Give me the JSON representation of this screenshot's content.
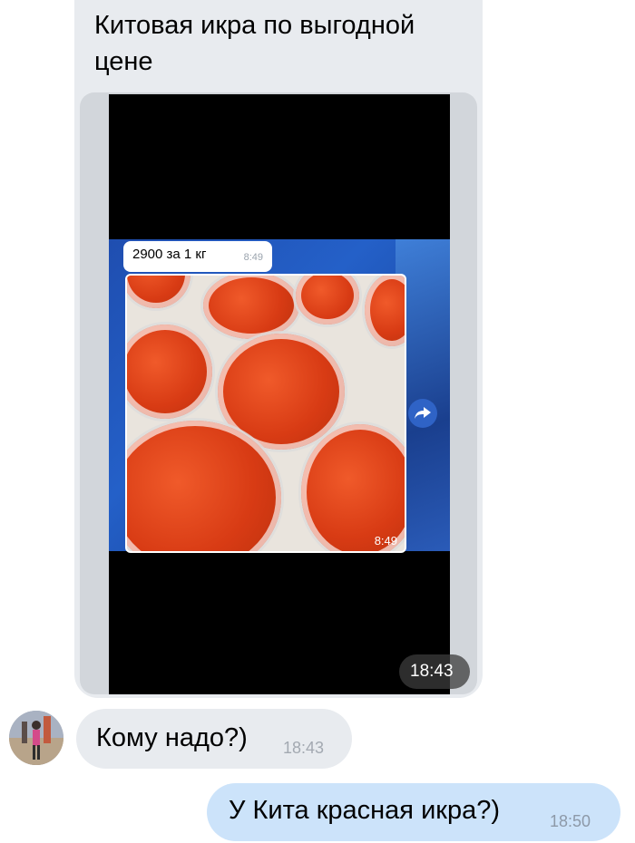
{
  "messages": {
    "first": {
      "text": "Китовая икра по выгодной цене",
      "time": "18:43",
      "attachment": {
        "caption": "2900 за 1 кг",
        "caption_time": "8:49",
        "photo_time": "8:49",
        "forward_icon": "forward-arrow-icon"
      }
    },
    "second": {
      "text": "Кому надо?)",
      "time": "18:43"
    },
    "outgoing": {
      "text": "У Кита красная икра?)",
      "time": "18:50"
    }
  },
  "colors": {
    "incoming_bubble": "#e8ebef",
    "outgoing_bubble": "#cce3fa",
    "accent_blue": "#2f63c6",
    "caviar": "#d83b14"
  }
}
